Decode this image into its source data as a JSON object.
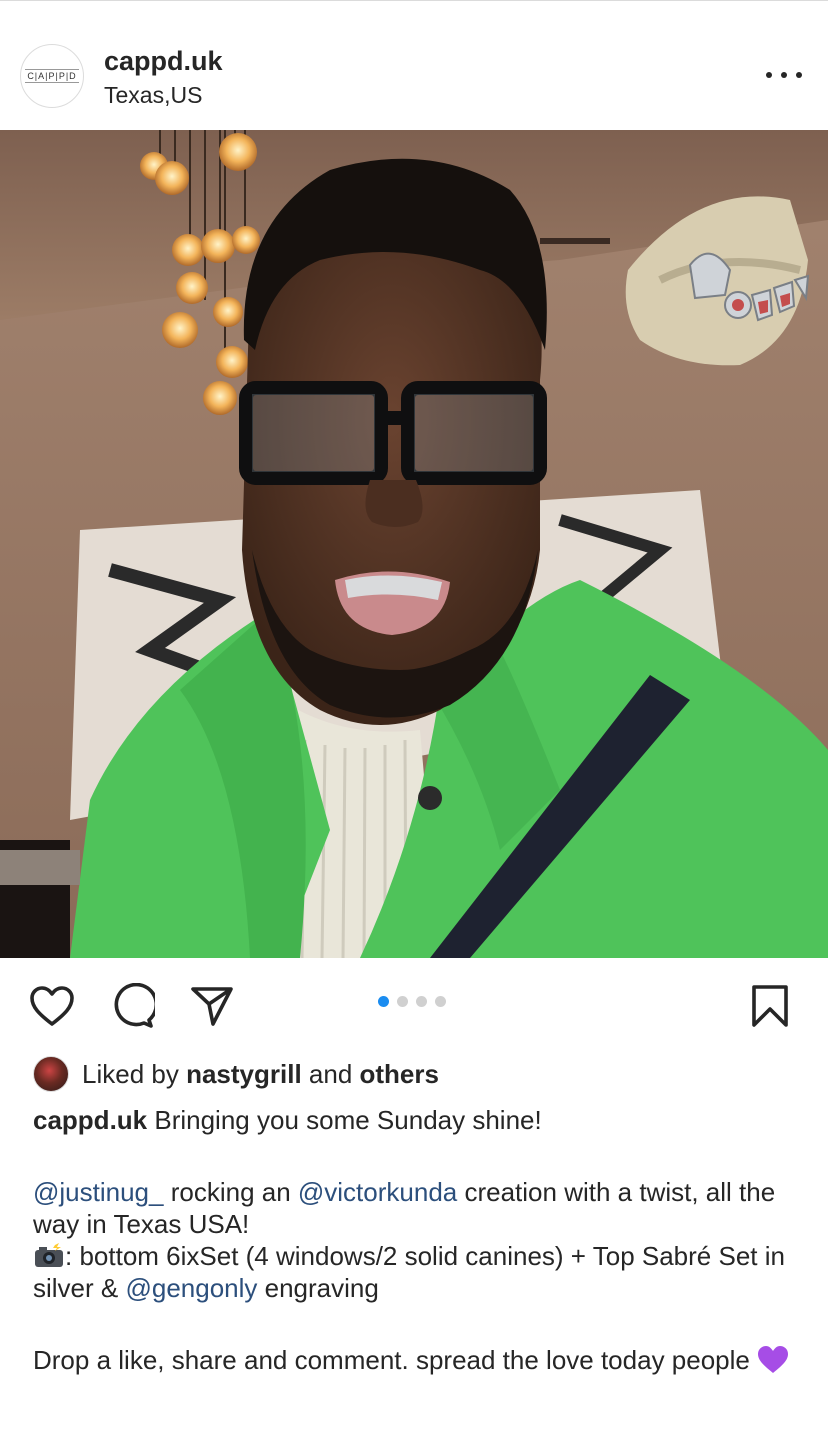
{
  "post": {
    "username": "cappd.uk",
    "location": "Texas,US",
    "avatar_text": "C|A|P|P|D",
    "carousel": {
      "total": 4,
      "active_index": 1
    },
    "likes": {
      "prefix": "Liked by ",
      "user": "nastygrill",
      "middle": " and ",
      "others": "others"
    },
    "caption": {
      "author": "cappd.uk",
      "line1": " Bringing you some Sunday shine!",
      "mention1": "@justinug_",
      "text2": " rocking an ",
      "mention2": "@victorkunda",
      "text3": " creation with a twist, all the way in Texas USA!",
      "text4": ": bottom 6ixSet (4 windows/2 solid canines) + Top Sabré Set in silver & ",
      "mention3": "@gengonly",
      "text5": " engraving",
      "text6": "Drop a like, share and comment. spread the love today people "
    }
  },
  "icons": {
    "like": "heart-icon",
    "comment": "comment-icon",
    "share": "send-icon",
    "save": "bookmark-icon",
    "more": "more-icon"
  },
  "colors": {
    "accent_dot": "#1a8cf0",
    "mention": "#2c4f7c",
    "jacket_green": "#4fc35a"
  }
}
